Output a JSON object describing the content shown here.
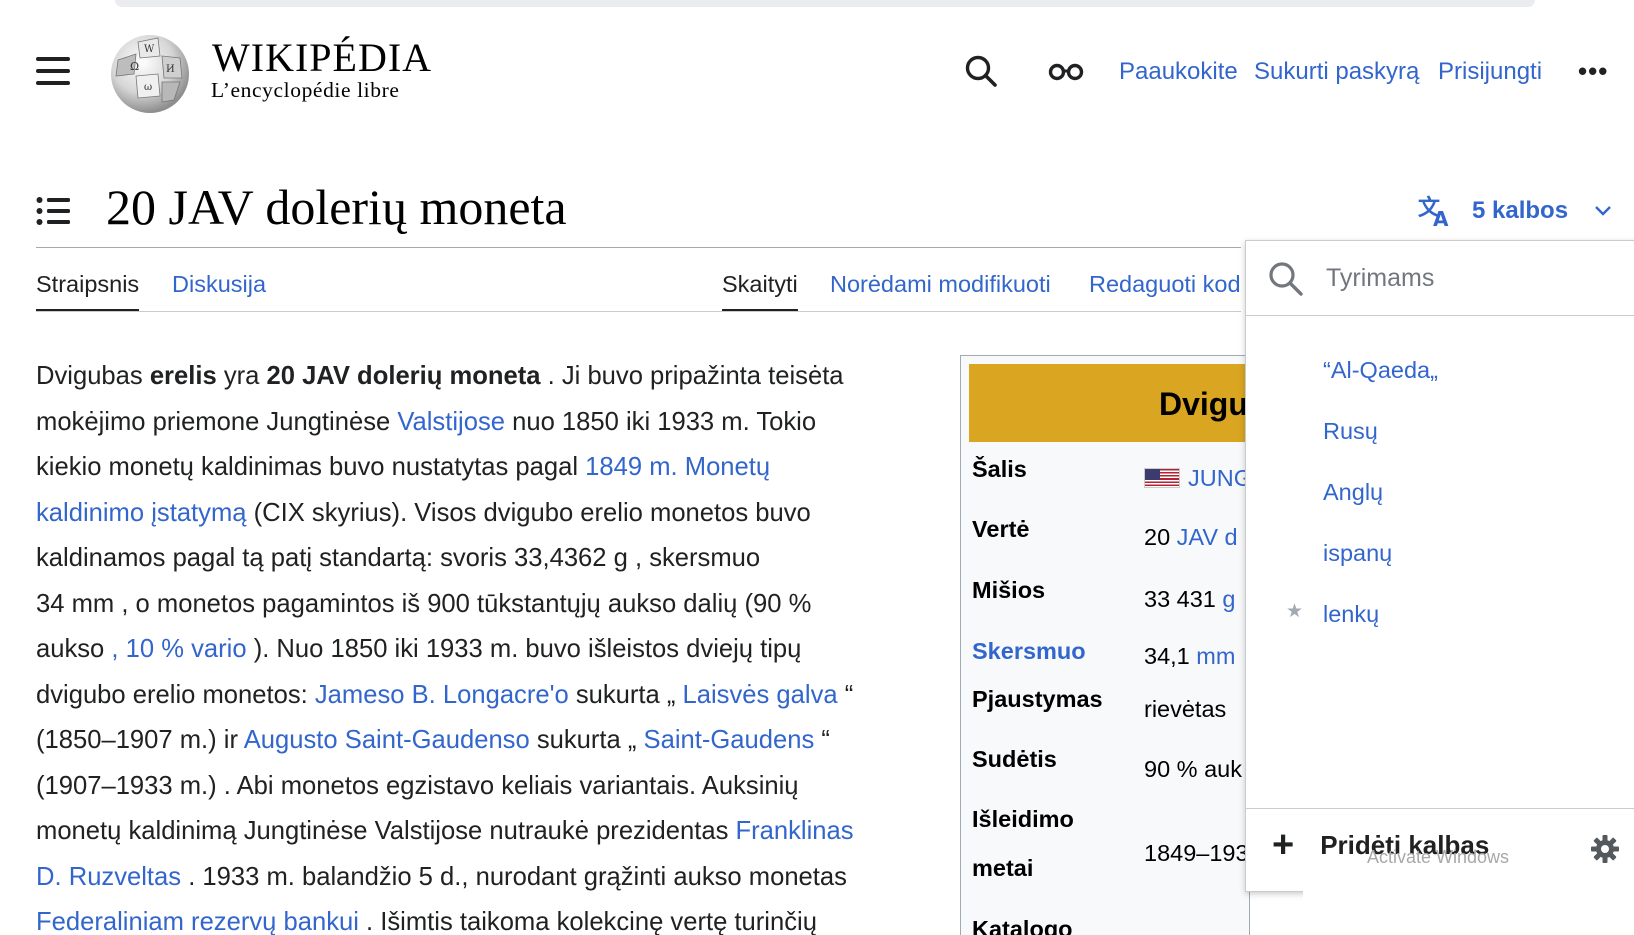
{
  "header": {
    "wordmark": "WIKIPÉDIA",
    "tagline": "L’encyclopédie libre",
    "links": [
      "Paaukokite",
      "Sukurti paskyrą",
      "Prisijungti"
    ],
    "more": "•••"
  },
  "page": {
    "title": "20 JAV dolerių moneta",
    "languages_label": "5 kalbos"
  },
  "tabs": {
    "left": [
      "Straipsnis",
      "Diskusija"
    ],
    "right": [
      "Skaityti",
      "Norėdami modifikuoti",
      "Redaguoti kod"
    ]
  },
  "body": {
    "l1a": "Dvigubas ",
    "l1b": "erelis",
    "l1c": " yra ",
    "l1d": "20 JAV dolerių moneta",
    "l1e": " . Ji buvo pripažinta teisėta",
    "l2a": "mokėjimo priemone Jungtinėse ",
    "l2b": "Valstijose",
    "l2c": " nuo 1850 iki 1933 m. Tokio",
    "l3a": "kiekio monetų kaldinimas buvo nustatytas pagal ",
    "l3b": "1849 m. Monetų",
    "l4a": "kaldinimo įstatymą",
    "l4b": " (CIX skyrius). Visos dvigubo erelio monetos buvo",
    "l5": "kaldinamos pagal tą patį standartą: svoris 33,4362 g , skersmuo",
    "l6": "34 mm , o monetos pagamintos iš 900 tūkstantųjų aukso dalių (90 %",
    "l7a": "aukso ",
    "l7b": ", 10 % ",
    "l7c": "vario",
    "l7d": " ). Nuo 1850 iki 1933 m. buvo išleistos dviejų tipų",
    "l8a": "dvigubo erelio monetos: ",
    "l8b": "Jameso B. Longacre'o",
    "l8c": " sukurta „ ",
    "l8d": "Laisvės galva",
    "l8e": " “",
    "l9a": "(1850–1907 m.) ir ",
    "l9b": "Augusto Saint-Gaudenso",
    "l9c": " sukurta „ ",
    "l9d": "Saint-Gaudens",
    "l9e": " “",
    "l10": "(1907–1933 m.) . Abi monetos egzistavo keliais variantais. Auksinių",
    "l11a": "monetų kaldinimą Jungtinėse Valstijose nutraukė prezidentas ",
    "l11b": "Franklinas",
    "l12a": "D. Ruzveltas",
    "l12b": " . 1933 m. balandžio 5 d., nurodant grąžinti aukso monetas",
    "l13a": "Federaliniam rezervų bankui",
    "l13b": " . Išimtis taikoma kolekcinę vertę turinčių"
  },
  "infobox": {
    "heading": "Dvigu",
    "rows": [
      {
        "label": "Šalis",
        "value": "JUNG"
      },
      {
        "label": "Vertė",
        "value_a": "20  ",
        "value_b": "JAV d"
      },
      {
        "label": "Mišios",
        "value_a": "33 431  ",
        "value_b": "g"
      },
      {
        "label": "Skersmuo",
        "value_a": "34,1  ",
        "value_b": "mm"
      },
      {
        "label": "Pjaustymas",
        "value": "rievėtas"
      },
      {
        "label": "Sudėtis",
        "value": "90 % auk"
      },
      {
        "label_a": "Išleidimo",
        "label_b": "metai",
        "value": "1849–193"
      },
      {
        "label": "Katalogo"
      }
    ]
  },
  "language_panel": {
    "search_placeholder": "Tyrimams",
    "items": [
      "“Al-Qaeda„",
      "Rusų",
      "Anglų",
      "ispanų",
      "lenkų"
    ],
    "add_label": "Pridėti kalbas",
    "watermark": "Activate Windows"
  },
  "colors": {
    "link": "#3366cc",
    "infobox_header": "#daa520",
    "text": "#202122"
  }
}
